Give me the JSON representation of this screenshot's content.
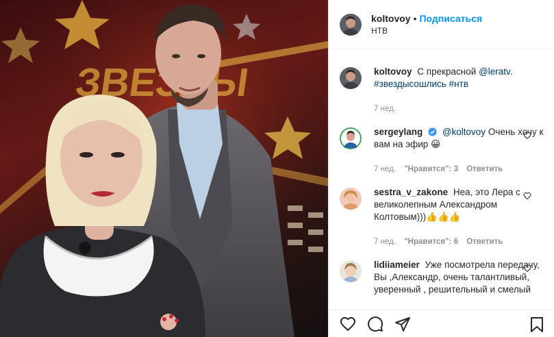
{
  "post": {
    "author": "koltovoy",
    "follow_label": "Подписаться",
    "separator": "•",
    "location": "НТВ"
  },
  "caption": {
    "author": "koltovoy",
    "text_prefix": "С прекрасной",
    "mention": "@leratv",
    "text_suffix": ".",
    "hashtags": "#звездысошлись #нтв",
    "time": "7 нед."
  },
  "comments": [
    {
      "author": "sergeylang",
      "verified": true,
      "mention": "@koltovoy",
      "text": "Очень хочу к вам на эфир 😀",
      "time": "7 нед.",
      "likes": "\"Нравится\": 3",
      "reply": "Ответить"
    },
    {
      "author": "sestra_v_zakone",
      "text": "Неа, это Лера с великолепным Александром Колтовым)))👍👍👍",
      "time": "7 нед.",
      "likes": "\"Нравится\": 6",
      "reply": "Ответить"
    },
    {
      "author": "lidiiameier",
      "text": "Уже посмотрела передачу, Вы ,Александр, очень талантливый, уверенный , решительный и смелый"
    }
  ],
  "photo": {
    "studio_sign": "ЗВЕЗДЫ"
  },
  "icons": {
    "like": "heart-icon",
    "comment": "comment-icon",
    "share": "share-icon",
    "save": "bookmark-icon",
    "verified": "verified-badge-icon"
  },
  "colors": {
    "link": "#0095f6",
    "tag": "#00376b",
    "muted": "#8e8e8e"
  }
}
